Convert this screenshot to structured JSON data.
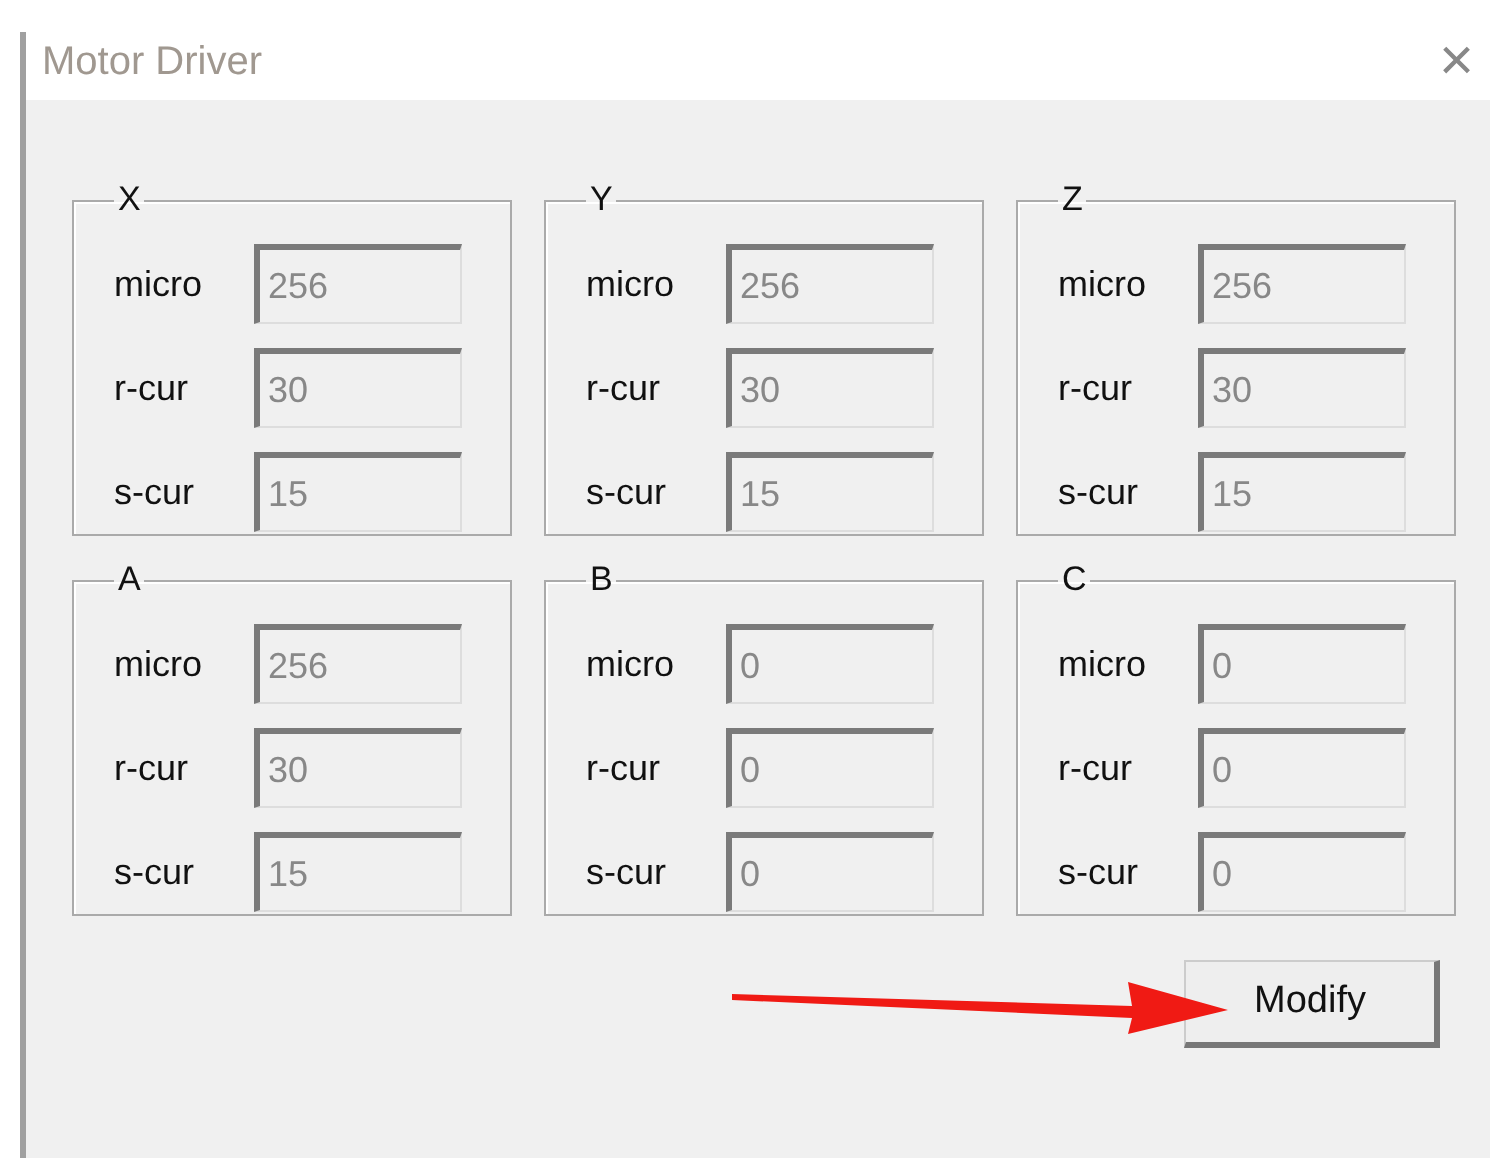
{
  "window": {
    "title": "Motor Driver",
    "close": "×"
  },
  "groups": [
    {
      "title": "X",
      "rows": [
        {
          "label": "micro",
          "value": "256"
        },
        {
          "label": "r-cur",
          "value": "30"
        },
        {
          "label": "s-cur",
          "value": "15"
        }
      ]
    },
    {
      "title": "Y",
      "rows": [
        {
          "label": "micro",
          "value": "256"
        },
        {
          "label": "r-cur",
          "value": "30"
        },
        {
          "label": "s-cur",
          "value": "15"
        }
      ]
    },
    {
      "title": "Z",
      "rows": [
        {
          "label": "micro",
          "value": "256"
        },
        {
          "label": "r-cur",
          "value": "30"
        },
        {
          "label": "s-cur",
          "value": "15"
        }
      ]
    },
    {
      "title": "A",
      "rows": [
        {
          "label": "micro",
          "value": "256"
        },
        {
          "label": "r-cur",
          "value": "30"
        },
        {
          "label": "s-cur",
          "value": "15"
        }
      ]
    },
    {
      "title": "B",
      "rows": [
        {
          "label": "micro",
          "value": "0"
        },
        {
          "label": "r-cur",
          "value": "0"
        },
        {
          "label": "s-cur",
          "value": "0"
        }
      ]
    },
    {
      "title": "C",
      "rows": [
        {
          "label": "micro",
          "value": "0"
        },
        {
          "label": "r-cur",
          "value": "0"
        },
        {
          "label": "s-cur",
          "value": "0"
        }
      ]
    }
  ],
  "buttons": [
    "Modify"
  ]
}
